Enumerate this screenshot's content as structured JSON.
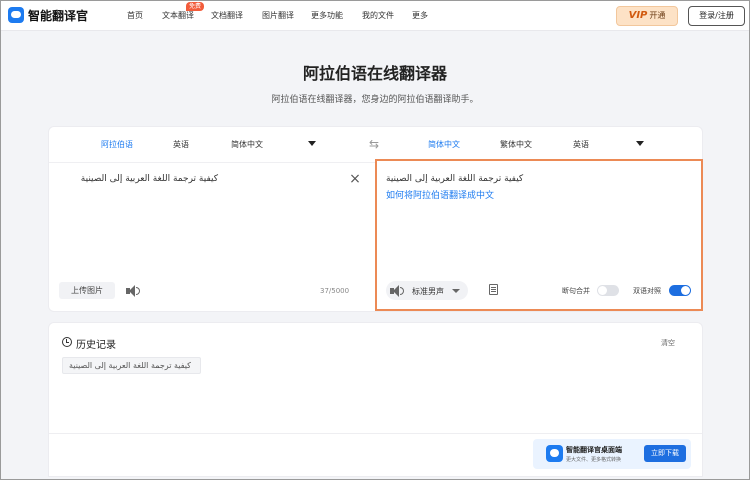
{
  "nav": {
    "brand": "智能翻译官",
    "items": [
      "首页",
      "文本翻译",
      "文档翻译",
      "图片翻译",
      "更多功能",
      "我的文件",
      "更多"
    ],
    "free_badge": "免费",
    "vip_label_icon": "VIP",
    "vip_label": "开通",
    "login_label": "登录/注册"
  },
  "hero": {
    "title": "阿拉伯语在线翻译器",
    "subtitle": "阿拉伯语在线翻译器，您身边的阿拉伯语翻译助手。"
  },
  "translator": {
    "source_langs": [
      "阿拉伯语",
      "英语",
      "简体中文"
    ],
    "target_langs": [
      "简体中文",
      "繁体中文",
      "英语"
    ],
    "source_text": "كيفية ترجمة اللغة العربية إلى الصينية",
    "upload_label": "上传图片",
    "char_count": "37/5000",
    "target_source_echo": "كيفية ترجمة اللغة العربية إلى الصينية",
    "target_text": "如何将阿拉伯语翻译成中文",
    "voice": "标准男声",
    "merge_label": "断句合并",
    "merge_on": false,
    "bilingual_label": "双语对照",
    "bilingual_on": true
  },
  "history": {
    "title": "历史记录",
    "clear_label": "清空",
    "items": [
      "كيفية ترجمة اللغة العربية إلى الصينية"
    ]
  },
  "promo": {
    "title": "智能翻译官桌面端",
    "subtitle": "更大文件、更多格式转换",
    "button": "立即下载"
  },
  "colors": {
    "accent": "#1d7bf0",
    "highlight_border": "#ec8a55"
  }
}
